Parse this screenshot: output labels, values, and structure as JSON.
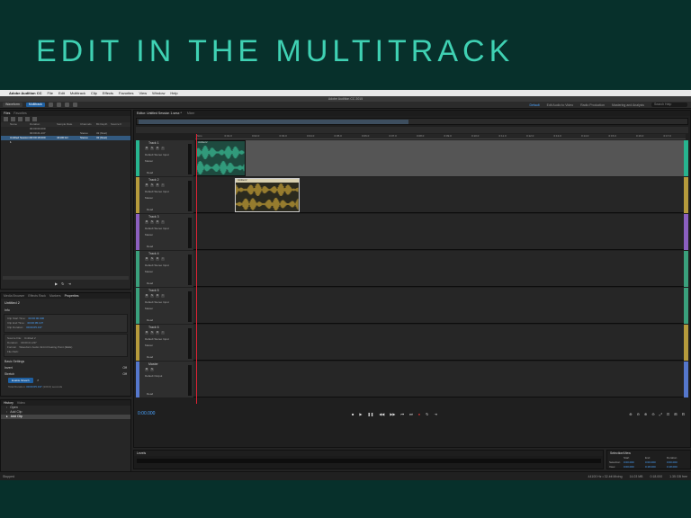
{
  "slide_title": "EDIT IN THE MULTITRACK",
  "menubar": {
    "app_name": "Adobe Audition CC",
    "items": [
      "File",
      "Edit",
      "Multitrack",
      "Clip",
      "Effects",
      "Favorites",
      "View",
      "Window",
      "Help"
    ]
  },
  "window_title": "Adobe Audition CC 2015",
  "toolbar": {
    "waveform": "Waveform",
    "multitrack": "Multitrack",
    "workspaces": [
      "Default",
      "Edit Audio to Video",
      "Radio Production",
      "Mastering and Analysis"
    ],
    "search_placeholder": "Search Help"
  },
  "files_panel": {
    "tabs": [
      "Files",
      "Favorites"
    ],
    "columns": [
      "",
      "Name",
      "Duration",
      "Sample Rate",
      "Channels",
      "Bit Depth",
      "Source F"
    ],
    "rows": [
      [
        "",
        "",
        "00:00:00.000",
        "",
        "",
        "",
        ""
      ],
      [
        "",
        "",
        "00:00:21.237",
        "",
        "Stereo",
        "32 (float)",
        ""
      ],
      [
        "",
        "Untitled Session 1",
        "00:00:18.000",
        "44100 Hz",
        "Stereo",
        "32 (float)",
        ""
      ]
    ]
  },
  "props_panel": {
    "tabs": [
      "Media Browser",
      "Effects Rack",
      "Markers",
      "Properties"
    ],
    "title": "Untitled 2",
    "info_label": "Info",
    "clip_lines": [
      {
        "label": "Clip Start Time:",
        "value": "00:00:00.000"
      },
      {
        "label": "Clip End Time:",
        "value": "00:00:05.137"
      },
      {
        "label": "Clip Duration:",
        "value": "00:00:05.137"
      }
    ],
    "source_lines": [
      {
        "label": "Source File:",
        "value": "Untitled 2"
      },
      {
        "label": "Duration:",
        "value": "00:00:21.237"
      },
      {
        "label": "Format:",
        "value": "Waveform Audio 32-bit Floating Point (IEEE)"
      },
      {
        "label": "File Path:",
        "value": ""
      }
    ],
    "sections": [
      {
        "name": "Basic Settings",
        "state": ""
      },
      {
        "name": "Invert",
        "state": "Off"
      },
      {
        "name": "Stretch",
        "state": "Off"
      }
    ],
    "enable_button": "Enable Stretch",
    "total_duration_label": "Total Duration:",
    "total_duration_value": "00:00:05.137",
    "total_duration_unit": "(100.0) seconds"
  },
  "history_panel": {
    "tabs": [
      "History",
      "Video"
    ],
    "items": [
      "Open",
      "Add Clip",
      "Add Clip"
    ],
    "footer": "2 Undos"
  },
  "editor": {
    "tabs": [
      "Editor: Untitled Session 1.sesx *",
      "Mixer"
    ],
    "ruler_ticks": [
      "hms",
      "0:01.0",
      "0:02.0",
      "0:03.0",
      "0:04.0",
      "0:05.0",
      "0:06.0",
      "0:07.0",
      "0:08.0",
      "0:09.0",
      "0:10.0",
      "0:11.0",
      "0:12.0",
      "0:13.0",
      "0:14.0",
      "0:15.0",
      "0:16.0",
      "0:17.0"
    ],
    "tracks": [
      {
        "name": "Track 1",
        "input": "Default Stereo Input",
        "output": "Master",
        "automation": "Read",
        "color": "#27b48f"
      },
      {
        "name": "Track 2",
        "input": "Default Stereo Input",
        "output": "Master",
        "automation": "Read",
        "color": "#b59a3c"
      },
      {
        "name": "Track 3",
        "input": "Default Stereo Input",
        "output": "Master",
        "automation": "Read",
        "color": "#8b5fbf"
      },
      {
        "name": "Track 4",
        "input": "Default Stereo Input",
        "output": "Master",
        "automation": "Read",
        "color": "#3aa07c"
      },
      {
        "name": "Track 5",
        "input": "Default Stereo Input",
        "output": "Master",
        "automation": "Read",
        "color": "#3aa07c"
      },
      {
        "name": "Track 6",
        "input": "Default Stereo Input",
        "output": "Master",
        "automation": "Read",
        "color": "#b59a3c"
      },
      {
        "name": "Master",
        "input": "",
        "output": "Default Output",
        "automation": "Read",
        "color": "#5577cc"
      }
    ],
    "clip1_label": "Untitled 2",
    "clip2_label": "Untitled 2",
    "timecode": "0:00.000",
    "transport_icons": [
      "stop",
      "play",
      "pause",
      "rewind",
      "fast-forward",
      "skip-back",
      "skip-forward",
      "record",
      "loop",
      "skip-clips"
    ],
    "zoom_icons": [
      "zoom-in-amp",
      "zoom-out-amp",
      "zoom-in",
      "zoom-out",
      "zoom-full",
      "zoom-selection",
      "zoom-in-selection",
      "zoom-in-tracks",
      "zoom-out-tracks"
    ]
  },
  "levels": {
    "tab": "Levels"
  },
  "selection_view": {
    "title": "Selection/View",
    "headers": [
      "",
      "Start",
      "End",
      "Duration"
    ],
    "rows": [
      [
        "Selection",
        "0:00.000",
        "0:00.000",
        "0:00.000"
      ],
      [
        "View",
        "0:00.000",
        "0:18.000",
        "0:18.000"
      ]
    ]
  },
  "status": {
    "left": "Stopped",
    "right": [
      "44100 Hz • 32-bit Mixing",
      "14.03 MB",
      "0:18.000",
      "1.35 GB free"
    ]
  }
}
